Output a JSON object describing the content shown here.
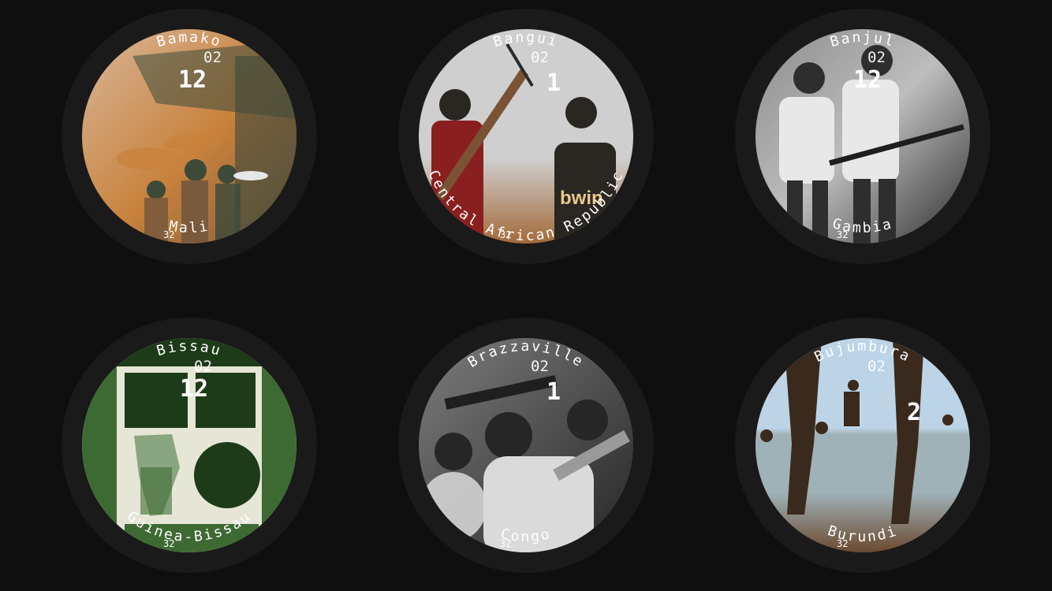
{
  "watches": [
    {
      "top": "Bamako",
      "bottom": "Mali",
      "date": "02",
      "hour": "12",
      "bottom_num": "32",
      "photo": "street-market-icon",
      "palette": {
        "a": "#d9b79a",
        "b": "#7a5a3c",
        "c": "#3d4a3a",
        "d": "#c8823c"
      }
    },
    {
      "top": "Bangui",
      "bottom": "Central African Republic",
      "date": "02",
      "hour": "1",
      "bottom_num": "32",
      "photo": "boys-with-weapons-icon",
      "palette": {
        "a": "#cfcfcf",
        "b": "#8a1f1f",
        "c": "#2a2622",
        "d": "#a36a3a"
      }
    },
    {
      "top": "Banjul",
      "bottom": "Gambia",
      "date": "02",
      "hour": "12",
      "bottom_num": "32",
      "photo": "women-with-rifles-icon",
      "palette": {
        "a": "#e8e8e8",
        "b": "#8c8c8c",
        "c": "#2e2e2e",
        "d": "#bdbdbd"
      }
    },
    {
      "top": "Bissau",
      "bottom": "Guinea-Bissau",
      "date": "02",
      "hour": "12",
      "bottom_num": "32",
      "photo": "green-poster-icon",
      "palette": {
        "a": "#e6e6d6",
        "b": "#3d6a33",
        "c": "#1d3b18",
        "d": "#8aa680"
      }
    },
    {
      "top": "Brazzaville",
      "bottom": "Congo",
      "date": "02",
      "hour": "1",
      "bottom_num": "32",
      "photo": "crowd-photo-icon",
      "palette": {
        "a": "#dadada",
        "b": "#7d7d7d",
        "c": "#262626",
        "d": "#b3b3b3"
      }
    },
    {
      "top": "Bujumbura",
      "bottom": "Burundi",
      "date": "02",
      "hour": "2",
      "bottom_num": "32",
      "photo": "lake-beach-icon",
      "palette": {
        "a": "#bcd4e6",
        "b": "#6b4a2f",
        "c": "#3a2a1e",
        "d": "#9fb2b8"
      }
    }
  ]
}
